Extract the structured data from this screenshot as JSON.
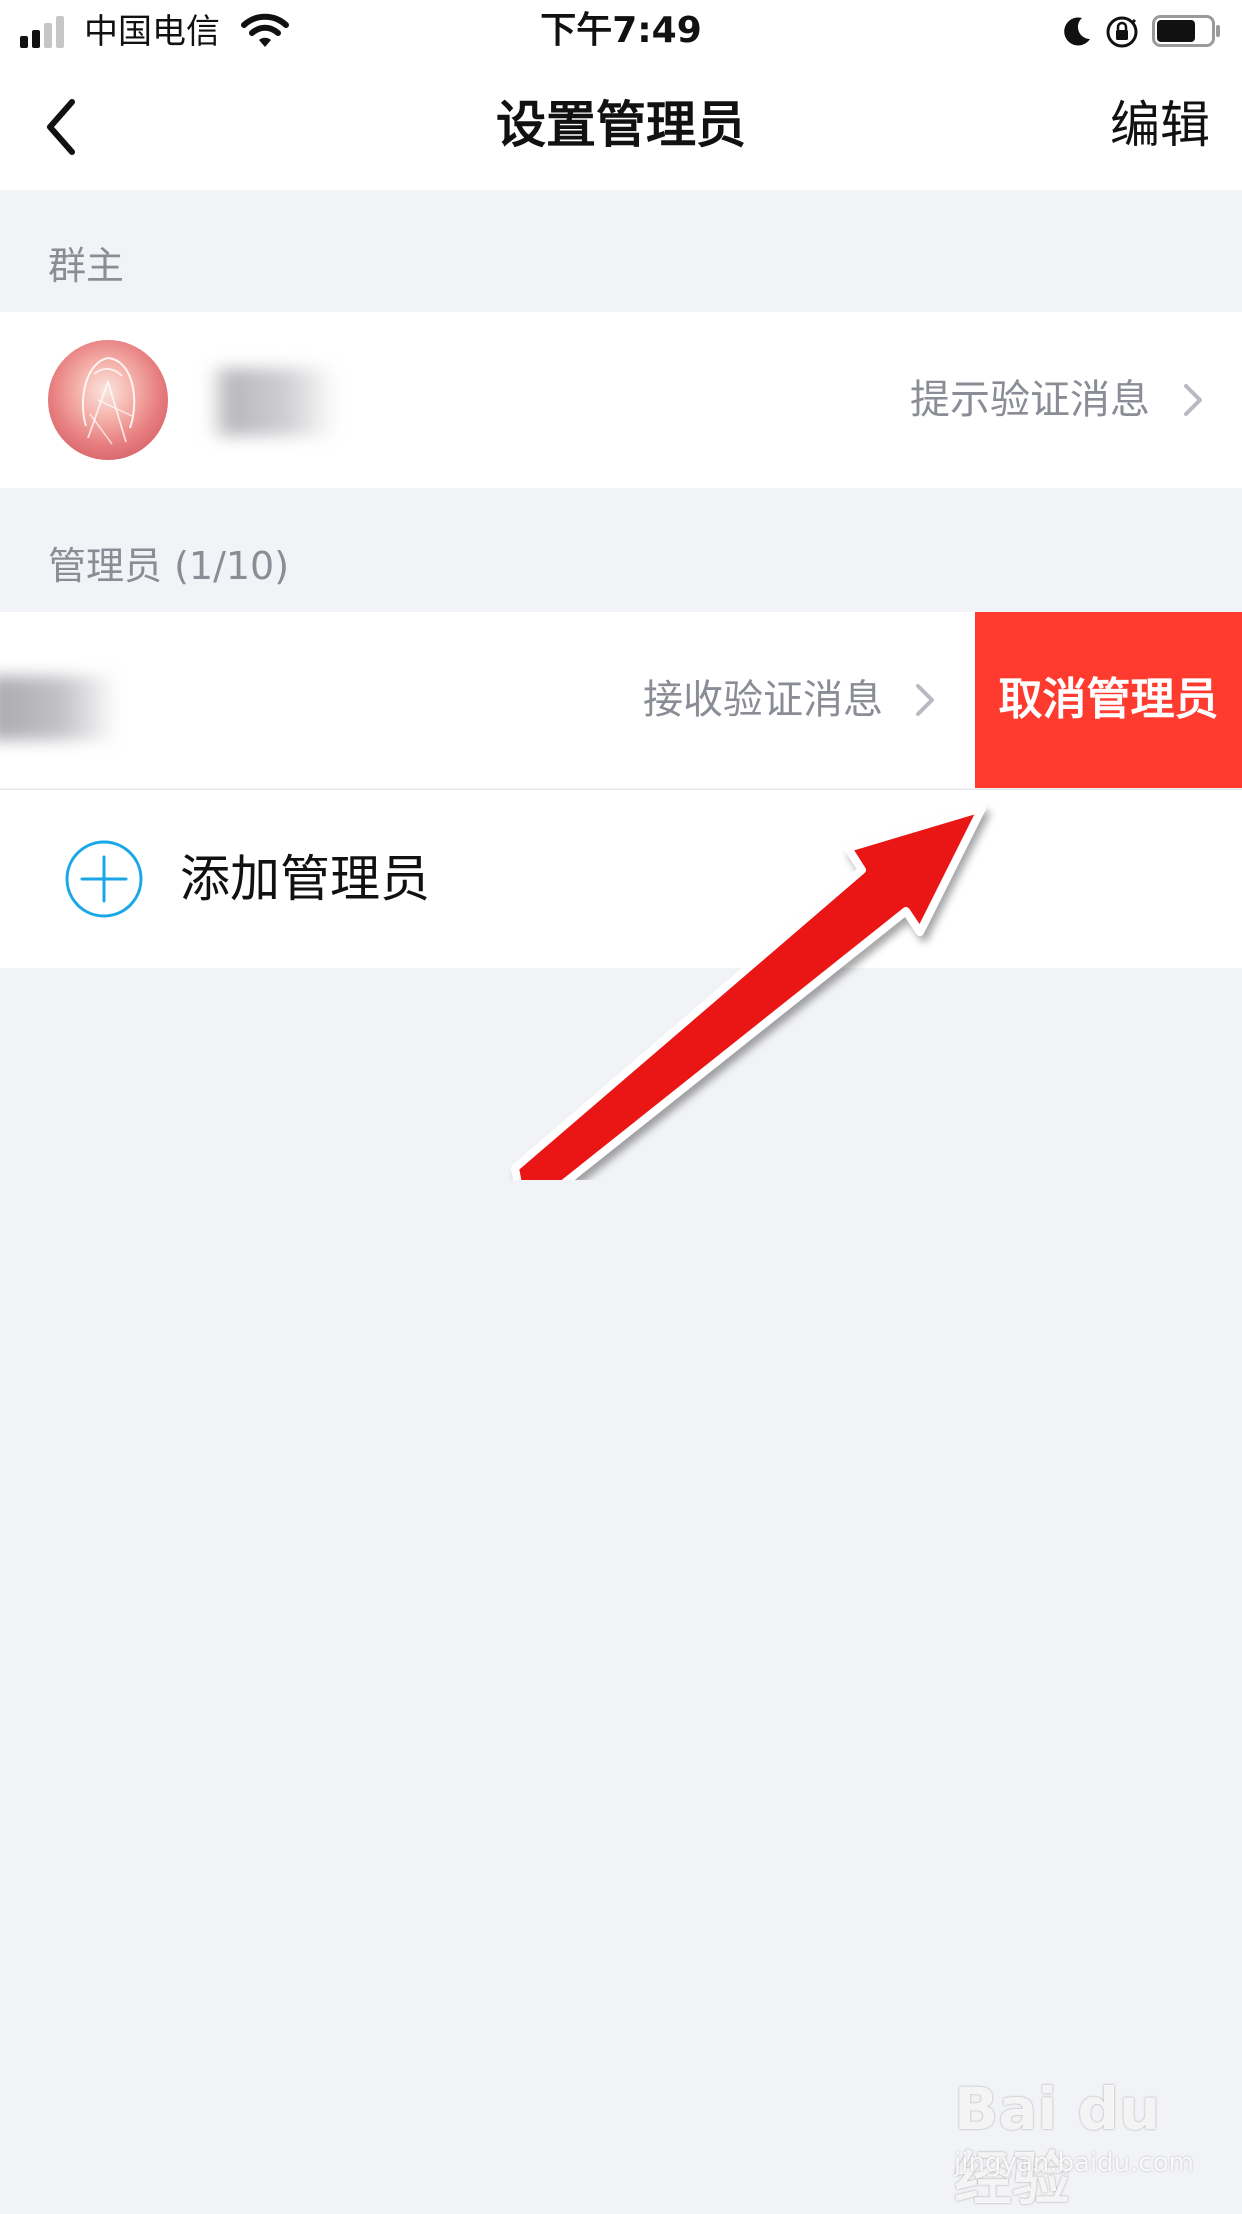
{
  "status_bar": {
    "carrier": "中国电信",
    "time": "下午7:49",
    "battery_level": 0.7
  },
  "header": {
    "title": "设置管理员",
    "edit_label": "编辑"
  },
  "owner_section": {
    "label": "群主",
    "row": {
      "right_text": "提示验证消息"
    }
  },
  "admin_section": {
    "label": "管理员 (1/10)",
    "row": {
      "right_text": "接收验证消息",
      "swipe_action_label": "取消管理员",
      "swipe_action_color": "#ff3b30"
    }
  },
  "add_admin": {
    "label": "添加管理员",
    "icon_color": "#1aa7e8"
  },
  "watermark": {
    "brand": "Bai du 经验",
    "url": "jingyan.baidu.com"
  },
  "colors": {
    "page_background": "#f2f3f7",
    "secondary_text": "#8b8d96",
    "annotation_arrow": "#e81616"
  }
}
